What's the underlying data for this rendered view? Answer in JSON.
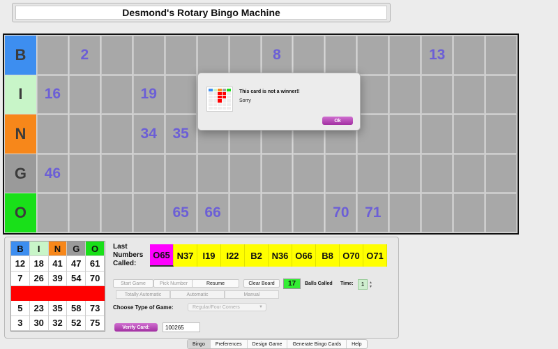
{
  "window": {
    "title": "Desmond's Rotary Bingo Machine"
  },
  "board": {
    "rows": [
      {
        "letter": "B",
        "color": "#3d8ef0",
        "cells": [
          "",
          "2",
          "",
          "",
          "",
          "",
          "",
          "8",
          "",
          "",
          "",
          "",
          "13",
          "",
          ""
        ]
      },
      {
        "letter": "I",
        "color": "#c8f5c8",
        "cells": [
          "16",
          "",
          "",
          "19",
          "",
          "",
          "",
          "",
          "",
          "",
          "",
          "",
          "",
          "",
          ""
        ]
      },
      {
        "letter": "N",
        "color": "#f7871a",
        "cells": [
          "",
          "",
          "",
          "34",
          "35",
          "",
          "",
          "",
          "",
          "",
          "",
          "",
          "",
          "",
          ""
        ]
      },
      {
        "letter": "G",
        "color": "#9a9a9a",
        "cells": [
          "46",
          "",
          "",
          "",
          "",
          "",
          "",
          "",
          "",
          "",
          "",
          "",
          "",
          "",
          ""
        ]
      },
      {
        "letter": "O",
        "color": "#19e019",
        "cells": [
          "",
          "",
          "",
          "",
          "65",
          "66",
          "",
          "",
          "",
          "70",
          "71",
          "",
          "",
          "",
          ""
        ]
      }
    ]
  },
  "card": {
    "headers": [
      {
        "letter": "B",
        "color": "#3d8ef0"
      },
      {
        "letter": "I",
        "color": "#c8f5c8"
      },
      {
        "letter": "N",
        "color": "#f7871a"
      },
      {
        "letter": "G",
        "color": "#9a9a9a"
      },
      {
        "letter": "O",
        "color": "#19e019"
      }
    ],
    "rows": [
      [
        "12",
        "18",
        "41",
        "47",
        "61"
      ],
      [
        "7",
        "26",
        "39",
        "54",
        "70"
      ],
      [
        "",
        "",
        "",
        "",
        ""
      ],
      [
        "5",
        "23",
        "35",
        "58",
        "73"
      ],
      [
        "3",
        "30",
        "32",
        "52",
        "75"
      ]
    ],
    "highlight_row": 2,
    "highlight_color": "#ff0000"
  },
  "last_numbers": {
    "label": "Last Numbers Called:",
    "balls": [
      "O65",
      "N37",
      "I19",
      "I22",
      "B2",
      "N36",
      "O66",
      "B8",
      "O70",
      "O71"
    ]
  },
  "controls": {
    "start_game": "Start Game",
    "pick_number": "Pick Number",
    "resume": "Resume",
    "clear_board": "Clear Board",
    "balls_called_count": "17",
    "balls_called_label": "Balls Called",
    "time_label": "Time:",
    "time_value": "1",
    "modes": [
      "Totally Automatic",
      "Automatic",
      "Manual"
    ],
    "game_type_label": "Choose Type of Game:",
    "game_type_value": "Regular/Four Corners",
    "verify_label": "Verify Card:",
    "verify_value": "100265"
  },
  "tabs": [
    "Bingo",
    "Preferences",
    "Design Game",
    "Generate Bingo Cards",
    "Help"
  ],
  "dialog": {
    "title": "This card is not a winner!!",
    "message": "Sorry",
    "ok_label": "Ok"
  }
}
